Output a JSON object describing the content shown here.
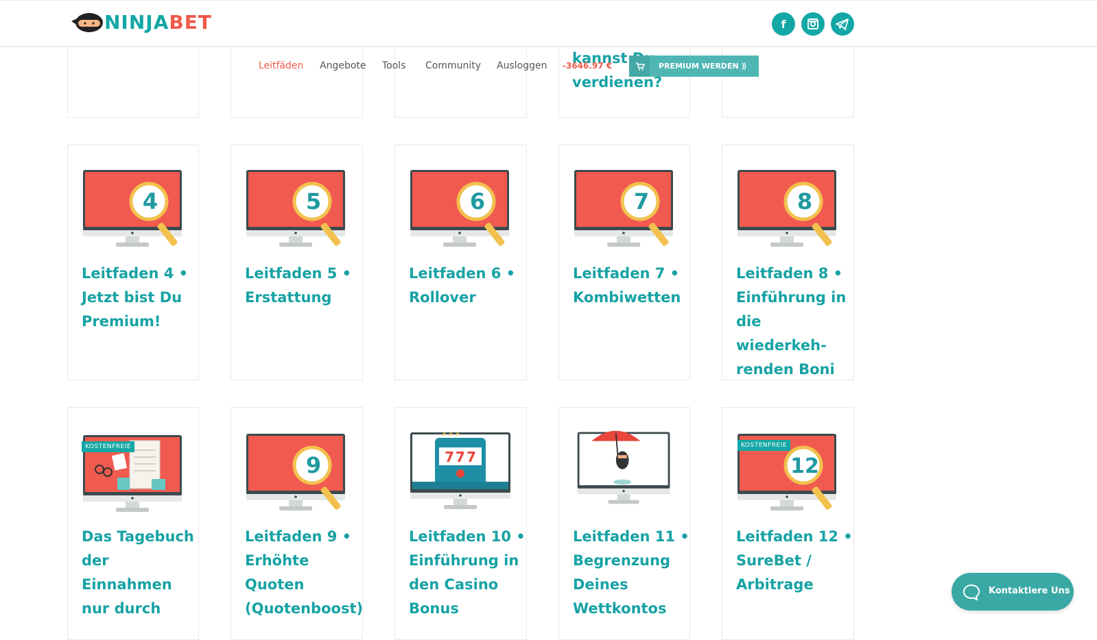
{
  "header": {
    "logo": {
      "part1": "NINJA",
      "part2": "BET"
    },
    "social": [
      {
        "name": "facebook-icon",
        "glyph": "f"
      },
      {
        "name": "instagram-icon",
        "glyph": ""
      },
      {
        "name": "telegram-icon",
        "glyph": ""
      }
    ]
  },
  "nav": {
    "items": [
      "Leitfäden",
      "Angebote",
      "Tools",
      "Community",
      "Ausloggen"
    ],
    "active": "Leitfäden",
    "balance": "-3646.97 €",
    "premium_label": "PREMIUM WERDEN ⟫"
  },
  "top_peek": {
    "line1": "kannst Du",
    "line2": "verdienen?"
  },
  "cards_row2": [
    {
      "number": "4",
      "lines": [
        "Leitfaden 4 •",
        "Jetzt bist Du",
        "Premium!"
      ]
    },
    {
      "number": "5",
      "lines": [
        "Leitfaden 5 •",
        "Erstattung"
      ]
    },
    {
      "number": "6",
      "lines": [
        "Leitfaden 6 •",
        "Rollover"
      ]
    },
    {
      "number": "7",
      "lines": [
        "Leitfaden 7 •",
        "Kombiwetten"
      ]
    },
    {
      "number": "8",
      "lines": [
        "Leitfaden 8 •",
        "Einführung in",
        "die wiederkeh-",
        "renden Boni"
      ]
    }
  ],
  "cards_row3": [
    {
      "badge": "KOSTENFREIE",
      "lines": [
        "Das Tagebuch",
        "der",
        "Einnahmen",
        "nur durch"
      ]
    },
    {
      "number": "9",
      "lines": [
        "Leitfaden 9 •",
        "Erhöhte",
        "Quoten",
        "(Quotenboost)"
      ]
    },
    {
      "slot": "777",
      "lines": [
        "Leitfaden 10 •",
        "Einführung in",
        "den Casino",
        "Bonus"
      ]
    },
    {
      "lines": [
        "Leitfaden 11 •",
        "Begrenzung",
        "Deines",
        "Wettkontos"
      ]
    },
    {
      "badge": "KOSTENFREIE",
      "number": "12",
      "lines": [
        "Leitfaden 12 •",
        "SureBet /",
        "Arbitrage"
      ]
    }
  ],
  "chat": {
    "label": "Kontaktiere Uns"
  },
  "colors": {
    "teal": "#17a2a4",
    "red": "#ef5a4a",
    "screen": "#f15a4f"
  }
}
